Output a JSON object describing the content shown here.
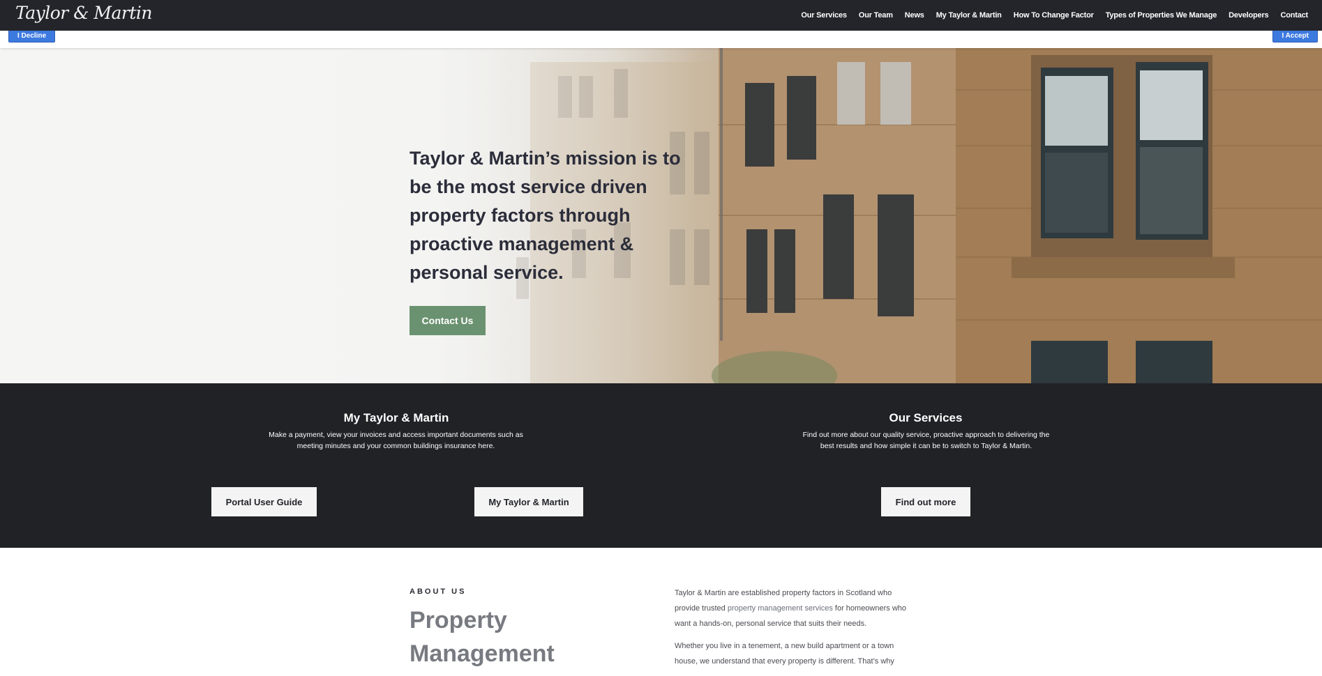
{
  "header": {
    "logo": "Taylor & Martin",
    "nav": [
      "Our Services",
      "Our Team",
      "News",
      "My Taylor & Martin",
      "How To Change Factor",
      "Types of Properties We Manage",
      "Developers",
      "Contact"
    ]
  },
  "cookie": {
    "decline": "I Decline",
    "accept": "I Accept"
  },
  "hero": {
    "heading": "Taylor & Martin’s mission is to be the most service driven property factors through proactive management & personal service.",
    "cta": "Contact Us"
  },
  "cards": {
    "portal": {
      "title": "My Taylor & Martin",
      "description": "Make a payment, view your invoices and access important documents such as meeting minutes and your common buildings insurance here.",
      "button_guide": "Portal User Guide",
      "button_portal": "My Taylor & Martin"
    },
    "services": {
      "title": "Our Services",
      "description": "Find out more about our quality service, proactive approach to delivering the best results and how simple it can be to switch to Taylor & Martin.",
      "button": "Find out more"
    }
  },
  "about": {
    "eyebrow": "ABOUT US",
    "title": "Property Management",
    "p1_before": "Taylor & Martin are established property factors in Scotland who provide trusted ",
    "p1_link": "property management services",
    "p1_after": " for homeowners who want a hands-on, personal service that suits their needs.",
    "p2": "Whether you live in a tenement, a new build apartment or a town house, we understand that every property is different. That’s why"
  },
  "colors": {
    "nav_bg": "#23252b",
    "accent_green": "#6b9270",
    "cookie_blue": "#3d7ae0",
    "dark_section": "#212226"
  }
}
